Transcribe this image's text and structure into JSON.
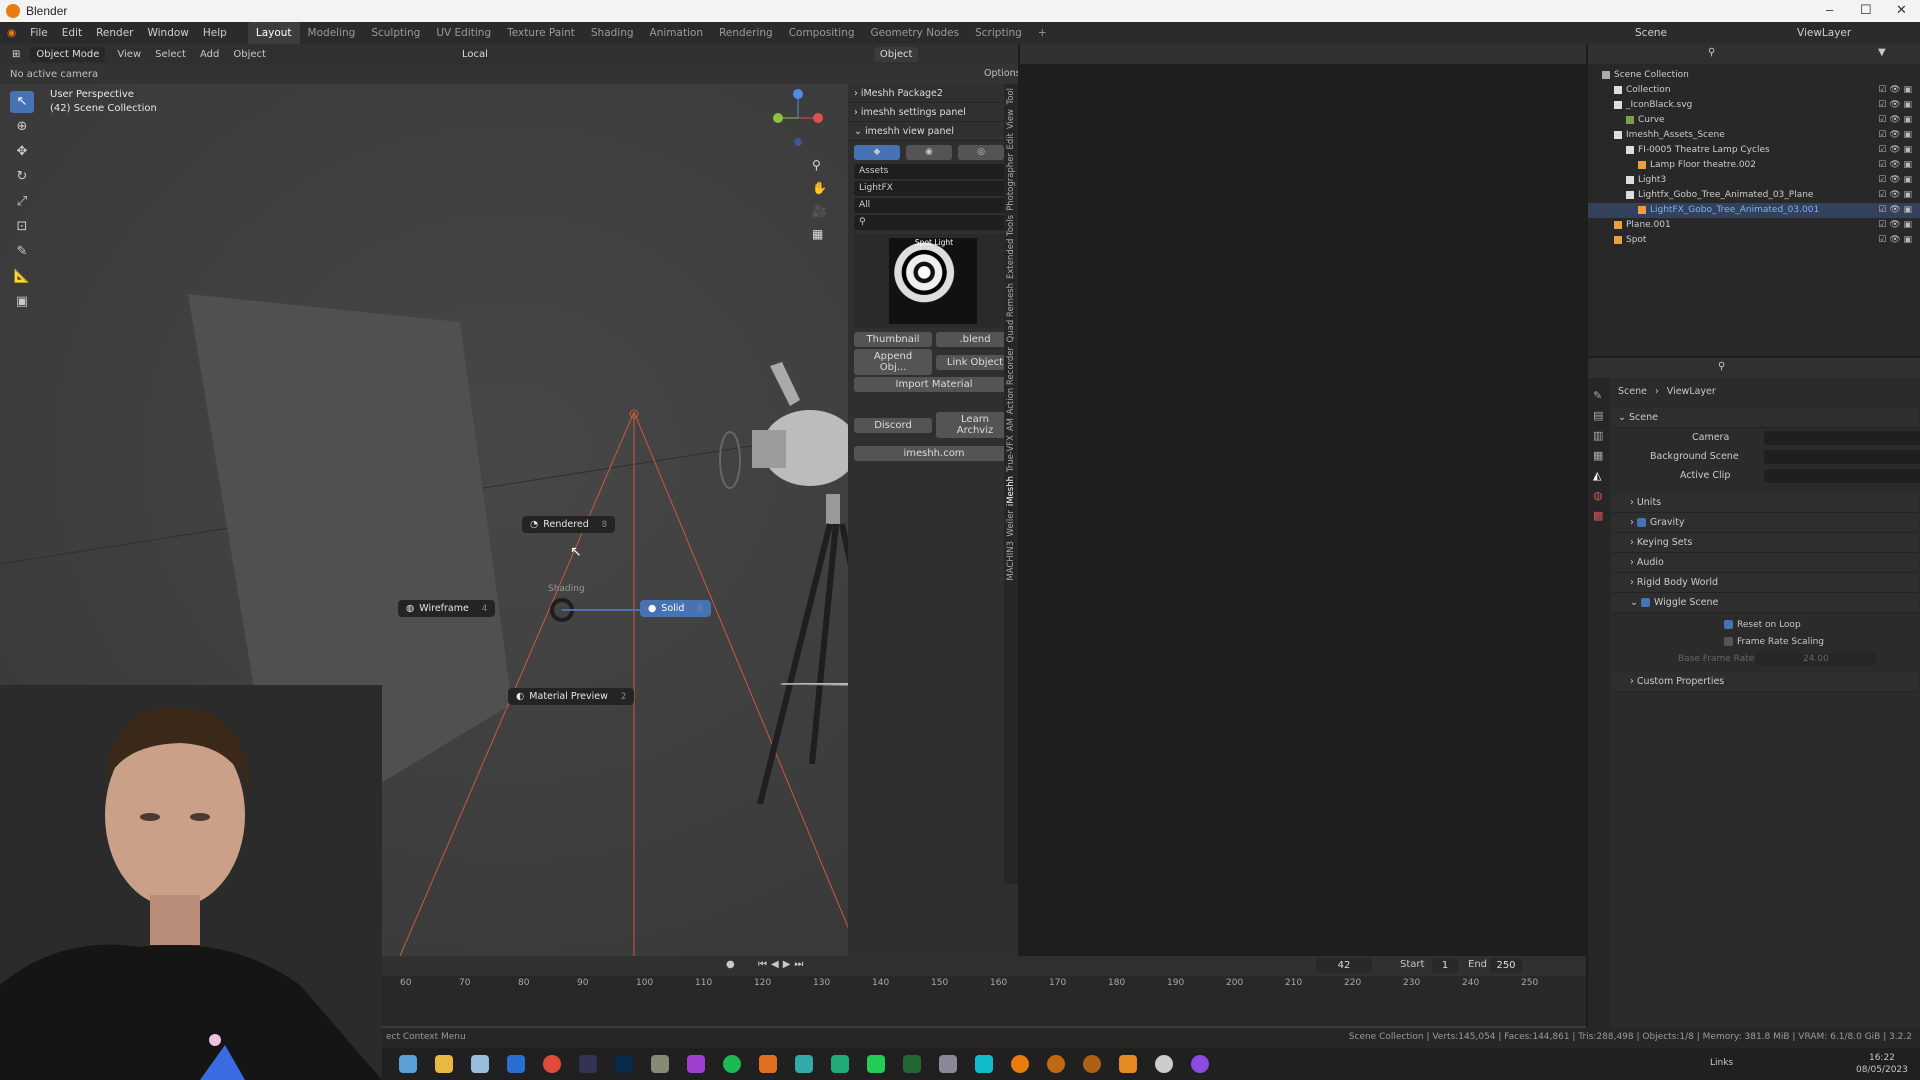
{
  "window": {
    "title": "Blender",
    "controls": [
      "–",
      "☐",
      "✕"
    ]
  },
  "menu": [
    "File",
    "Edit",
    "Render",
    "Window",
    "Help"
  ],
  "workspaces": [
    "Layout",
    "Modeling",
    "Sculpting",
    "UV Editing",
    "Texture Paint",
    "Shading",
    "Animation",
    "Rendering",
    "Compositing",
    "Geometry Nodes",
    "Scripting",
    "+"
  ],
  "active_workspace": "Layout",
  "scene": {
    "name": "Scene",
    "view_layer": "ViewLayer"
  },
  "viewport": {
    "mode": "Object Mode",
    "header_menus": [
      "View",
      "Select",
      "Add",
      "Object"
    ],
    "transform": "Local",
    "object_dropdown": "Object",
    "camera": "No active camera",
    "options": "Options",
    "overlay_line1": "User Perspective",
    "overlay_line2": "(42) Scene Collection"
  },
  "pie_menu": {
    "title": "Shading",
    "items": [
      {
        "label": "Rendered",
        "key": "8"
      },
      {
        "label": "Wireframe",
        "key": "4"
      },
      {
        "label": "Solid",
        "key": "6"
      },
      {
        "label": "Material Preview",
        "key": "2"
      }
    ],
    "selected": "Solid"
  },
  "imeshh": {
    "sections": [
      "iMeshh Package2",
      "imeshh settings panel",
      "imeshh view panel"
    ],
    "dropdowns": [
      "Assets",
      "LightFX",
      "All"
    ],
    "preview_label": "Spot Light",
    "thumbnail": "Thumbnail",
    "blend": ".blend",
    "append": "Append Obj...",
    "link": "Link Object",
    "import_material": "Import Material",
    "discord": "Discord",
    "learn": "Learn Archviz",
    "site": "imeshh.com"
  },
  "side_tabs": [
    "Tool",
    "View",
    "Edit",
    "Photographer",
    "Extended Tools",
    "Quad Remesh",
    "Action Recorder",
    "AM",
    "True-VFX",
    "iMeshh",
    "Weiler",
    "MACHIN3"
  ],
  "outliner": {
    "items": [
      {
        "label": "Scene Collection",
        "indent": 0
      },
      {
        "label": "Collection",
        "indent": 1
      },
      {
        "label": "_IconBlack.svg",
        "indent": 1
      },
      {
        "label": "Curve",
        "indent": 2
      },
      {
        "label": "Imeshh_Assets_Scene",
        "indent": 1
      },
      {
        "label": "FI-0005 Theatre Lamp Cycles",
        "indent": 2
      },
      {
        "label": "Lamp Floor theatre.002",
        "indent": 3
      },
      {
        "label": "Light3",
        "indent": 2
      },
      {
        "label": "Lightfx_Gobo_Tree_Animated_03_Plane",
        "indent": 2
      },
      {
        "label": "LightFX_Gobo_Tree_Animated_03.001",
        "indent": 3
      },
      {
        "label": "Plane.001",
        "indent": 1
      },
      {
        "label": "Spot",
        "indent": 1
      }
    ],
    "selected": "LightFX_Gobo_Tree_Animated_03.001"
  },
  "properties": {
    "breadcrumb": [
      "Scene",
      "ViewLayer"
    ],
    "scene_section": "Scene",
    "fields": [
      {
        "label": "Camera"
      },
      {
        "label": "Background Scene"
      },
      {
        "label": "Active Clip"
      }
    ],
    "panels": [
      {
        "label": "Units",
        "check": null
      },
      {
        "label": "Gravity",
        "check": true
      },
      {
        "label": "Keying Sets",
        "check": null
      },
      {
        "label": "Audio",
        "check": null
      },
      {
        "label": "Rigid Body World",
        "check": null
      },
      {
        "label": "Wiggle Scene",
        "check": true
      }
    ],
    "wiggle": {
      "reset": "Reset on Loop",
      "scaling": "Frame Rate Scaling",
      "base": "Base Frame Rate",
      "base_value": "24.00"
    },
    "custom": "Custom Properties"
  },
  "timeline": {
    "current": "42",
    "start_label": "Start",
    "start": "1",
    "end_label": "End",
    "end": "250",
    "ticks": [
      "60",
      "70",
      "80",
      "90",
      "100",
      "110",
      "120",
      "130",
      "140",
      "150",
      "160",
      "170",
      "180",
      "190",
      "200",
      "210",
      "220",
      "230",
      "240",
      "250"
    ]
  },
  "status": {
    "left": "ect Context Menu",
    "right": "Scene Collection | Verts:145,054 | Faces:144,861 | Tris:288,498 | Objects:1/8 | Memory: 381.8 MiB | VRAM: 6.1/8.0 GiB | 3.2.2"
  },
  "taskbar": {
    "lang": "Links",
    "time": "16:22",
    "date": "08/05/2023"
  }
}
